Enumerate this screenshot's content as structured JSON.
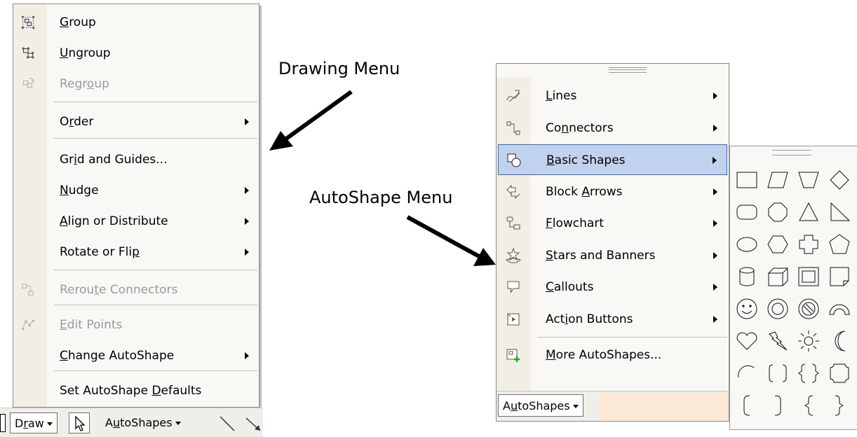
{
  "captions": {
    "drawing_menu": "Drawing Menu",
    "autoshape_menu": "AutoShape Menu"
  },
  "draw_menu": {
    "items": [
      {
        "pre": "",
        "acc": "G",
        "post": "roup",
        "icon": "group-icon",
        "enabled": true,
        "submenu": false
      },
      {
        "pre": "",
        "acc": "U",
        "post": "ngroup",
        "icon": "ungroup-icon",
        "enabled": true,
        "submenu": false
      },
      {
        "pre": "Regr",
        "acc": "o",
        "post": "up",
        "icon": "regroup-icon",
        "enabled": false,
        "submenu": false
      },
      {
        "pre": "O",
        "acc": "r",
        "post": "der",
        "icon": "",
        "enabled": true,
        "submenu": true
      },
      {
        "pre": "Gr",
        "acc": "i",
        "post": "d and Guides...",
        "icon": "",
        "enabled": true,
        "submenu": false
      },
      {
        "pre": "",
        "acc": "N",
        "post": "udge",
        "icon": "",
        "enabled": true,
        "submenu": true
      },
      {
        "pre": "",
        "acc": "A",
        "post": "lign or Distribute",
        "icon": "",
        "enabled": true,
        "submenu": true
      },
      {
        "pre": "Rotate or Fli",
        "acc": "p",
        "post": "",
        "icon": "",
        "enabled": true,
        "submenu": true
      },
      {
        "pre": "Rerou",
        "acc": "t",
        "post": "e Connectors",
        "icon": "reroute-connectors-icon",
        "enabled": false,
        "submenu": false
      },
      {
        "pre": "",
        "acc": "E",
        "post": "dit Points",
        "icon": "edit-points-icon",
        "enabled": false,
        "submenu": false
      },
      {
        "pre": "",
        "acc": "C",
        "post": "hange AutoShape",
        "icon": "",
        "enabled": true,
        "submenu": true
      },
      {
        "pre": "Set AutoShape ",
        "acc": "D",
        "post": "efaults",
        "icon": "",
        "enabled": true,
        "submenu": false
      }
    ]
  },
  "toolbar": {
    "draw_pre": "D",
    "draw_acc": "r",
    "draw_post": "aw",
    "autoshapes_pre": "A",
    "autoshapes_acc": "u",
    "autoshapes_post": "toShapes"
  },
  "autoshape_menu": {
    "items": [
      {
        "pre": "",
        "acc": "L",
        "post": "ines",
        "icon": "lines-icon",
        "submenu": true,
        "highlighted": false
      },
      {
        "pre": "Co",
        "acc": "n",
        "post": "nectors",
        "icon": "connectors-icon",
        "submenu": true,
        "highlighted": false
      },
      {
        "pre": "",
        "acc": "B",
        "post": "asic Shapes",
        "icon": "basic-shapes-icon",
        "submenu": true,
        "highlighted": true
      },
      {
        "pre": "Block ",
        "acc": "A",
        "post": "rrows",
        "icon": "block-arrows-icon",
        "submenu": true,
        "highlighted": false
      },
      {
        "pre": "",
        "acc": "F",
        "post": "lowchart",
        "icon": "flowchart-icon",
        "submenu": true,
        "highlighted": false
      },
      {
        "pre": "",
        "acc": "S",
        "post": "tars and Banners",
        "icon": "stars-banners-icon",
        "submenu": true,
        "highlighted": false
      },
      {
        "pre": "",
        "acc": "C",
        "post": "allouts",
        "icon": "callouts-icon",
        "submenu": true,
        "highlighted": false
      },
      {
        "pre": "Act",
        "acc": "i",
        "post": "on Buttons",
        "icon": "action-buttons-icon",
        "submenu": true,
        "highlighted": false
      },
      {
        "pre": "",
        "acc": "M",
        "post": "ore AutoShapes...",
        "icon": "more-autoshapes-icon",
        "submenu": false,
        "highlighted": false
      }
    ],
    "button_pre": "A",
    "button_acc": "u",
    "button_post": "toShapes"
  },
  "basic_shapes": [
    "rectangle",
    "parallelogram",
    "trapezoid",
    "diamond",
    "rounded-rectangle",
    "octagon",
    "isosceles-triangle",
    "right-triangle",
    "oval",
    "hexagon",
    "cross",
    "regular-pentagon",
    "can",
    "cube",
    "bevel",
    "folded-corner",
    "smiley-face",
    "donut",
    "no-symbol",
    "block-arc",
    "heart",
    "lightning-bolt",
    "sun",
    "moon",
    "arc",
    "double-bracket",
    "double-brace",
    "plaque",
    "left-bracket",
    "right-bracket",
    "left-brace",
    "right-brace"
  ]
}
